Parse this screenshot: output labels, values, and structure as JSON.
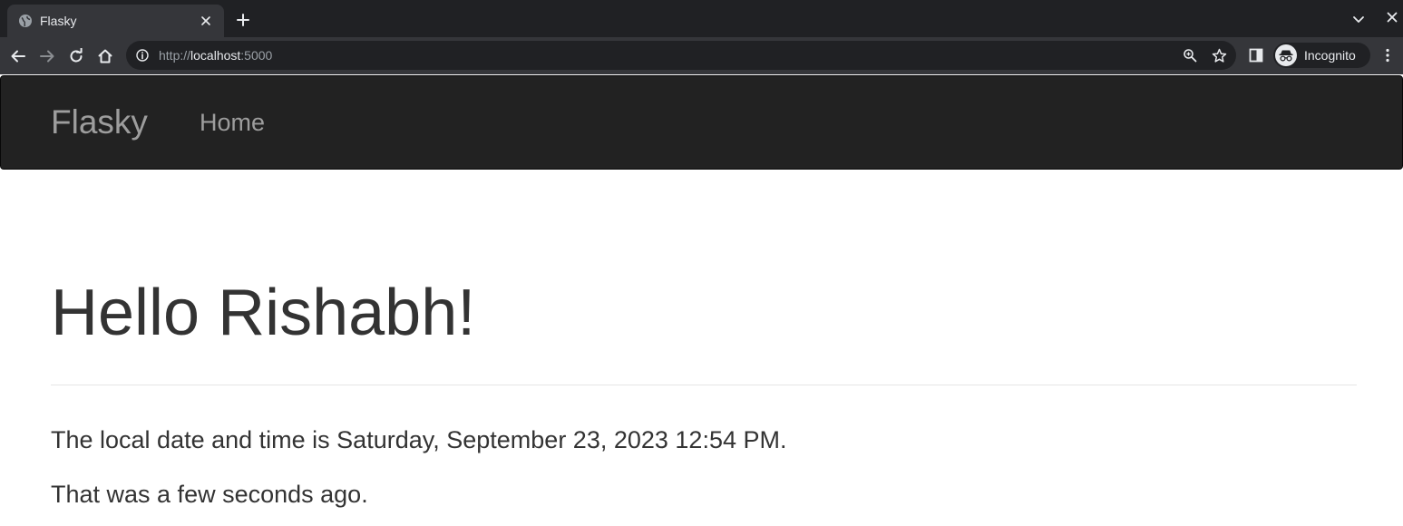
{
  "browser": {
    "tab": {
      "title": "Flasky",
      "favicon": "globe-icon"
    },
    "url": {
      "scheme": "http://",
      "host": "localhost",
      "port": ":5000"
    },
    "profile_label": "Incognito",
    "colors": {
      "tabstrip": "#202124",
      "toolbar": "#35363a",
      "text": "#e8eaed"
    }
  },
  "navbar": {
    "brand": "Flasky",
    "links": [
      {
        "label": "Home"
      }
    ],
    "colors": {
      "background": "#222222",
      "link": "#9d9d9d"
    }
  },
  "page": {
    "heading": "Hello Rishabh!",
    "datetime_line": "The local date and time is Saturday, September 23, 2023 12:54 PM.",
    "relative_line": "That was a few seconds ago.",
    "colors": {
      "text": "#333333",
      "divider": "#e6e6e6"
    }
  }
}
